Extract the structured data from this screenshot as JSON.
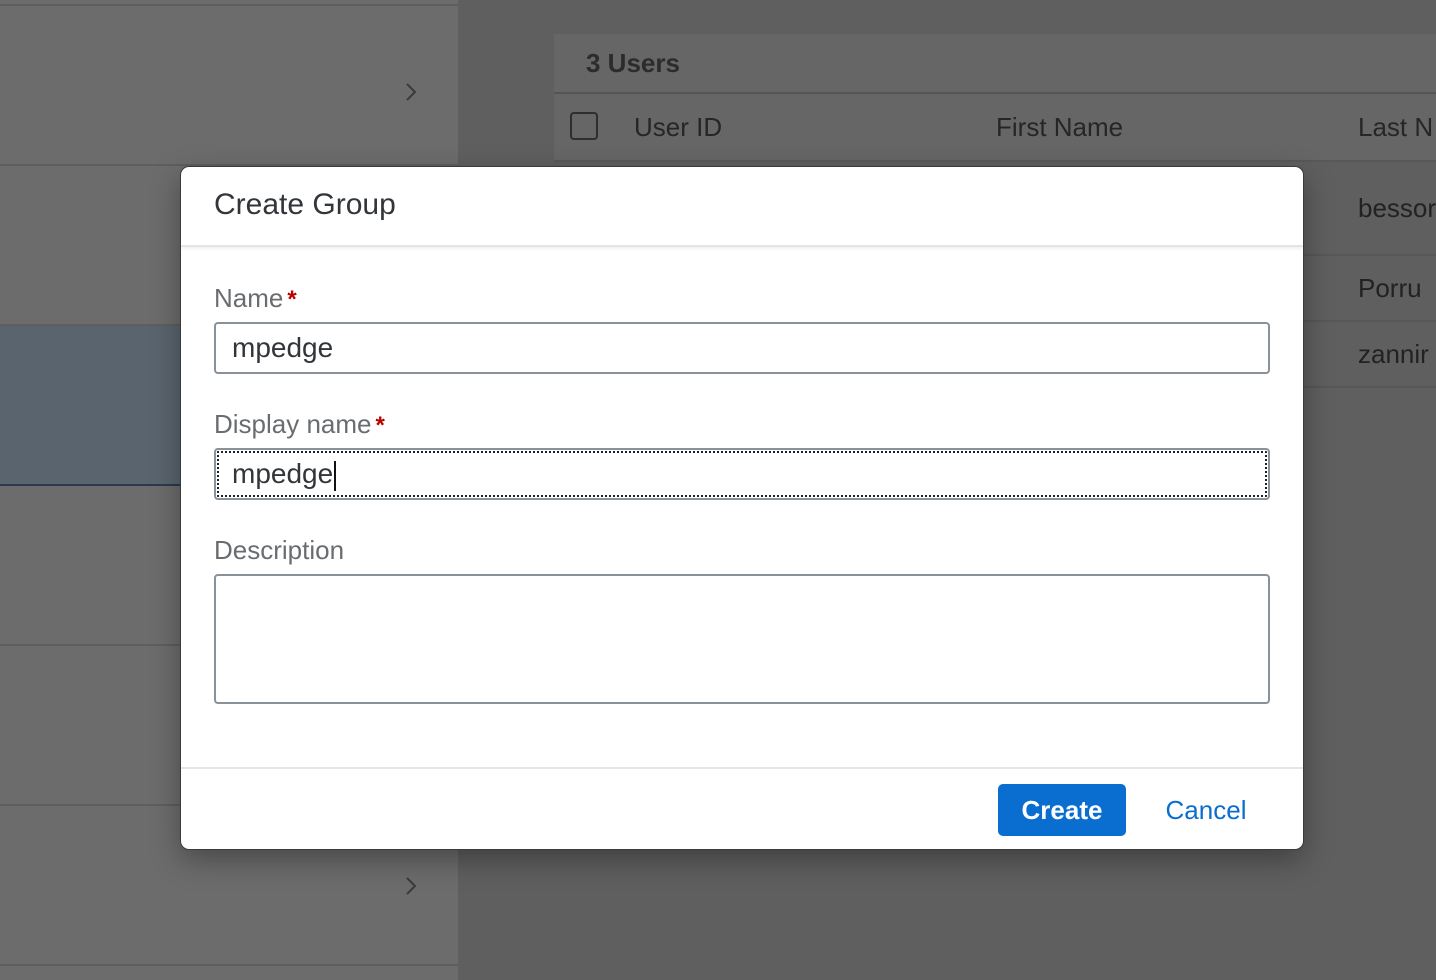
{
  "background": {
    "users_table": {
      "title": "3 Users",
      "columns": [
        "User ID",
        "First Name",
        "Last N"
      ],
      "rows": [
        {
          "last_name": "bessor"
        },
        {
          "last_name": "Porru"
        },
        {
          "last_name": "zannir"
        }
      ]
    }
  },
  "dialog": {
    "title": "Create Group",
    "fields": {
      "name": {
        "label": "Name",
        "required_mark": "*",
        "value": "mpedge"
      },
      "display_name": {
        "label": "Display name",
        "required_mark": "*",
        "value": "mpedge"
      },
      "description": {
        "label": "Description",
        "value": ""
      }
    },
    "buttons": {
      "create": "Create",
      "cancel": "Cancel"
    }
  },
  "colors": {
    "accent": "#0a6ed1",
    "required": "#bb0000",
    "overlay": "#5f5f5f"
  }
}
